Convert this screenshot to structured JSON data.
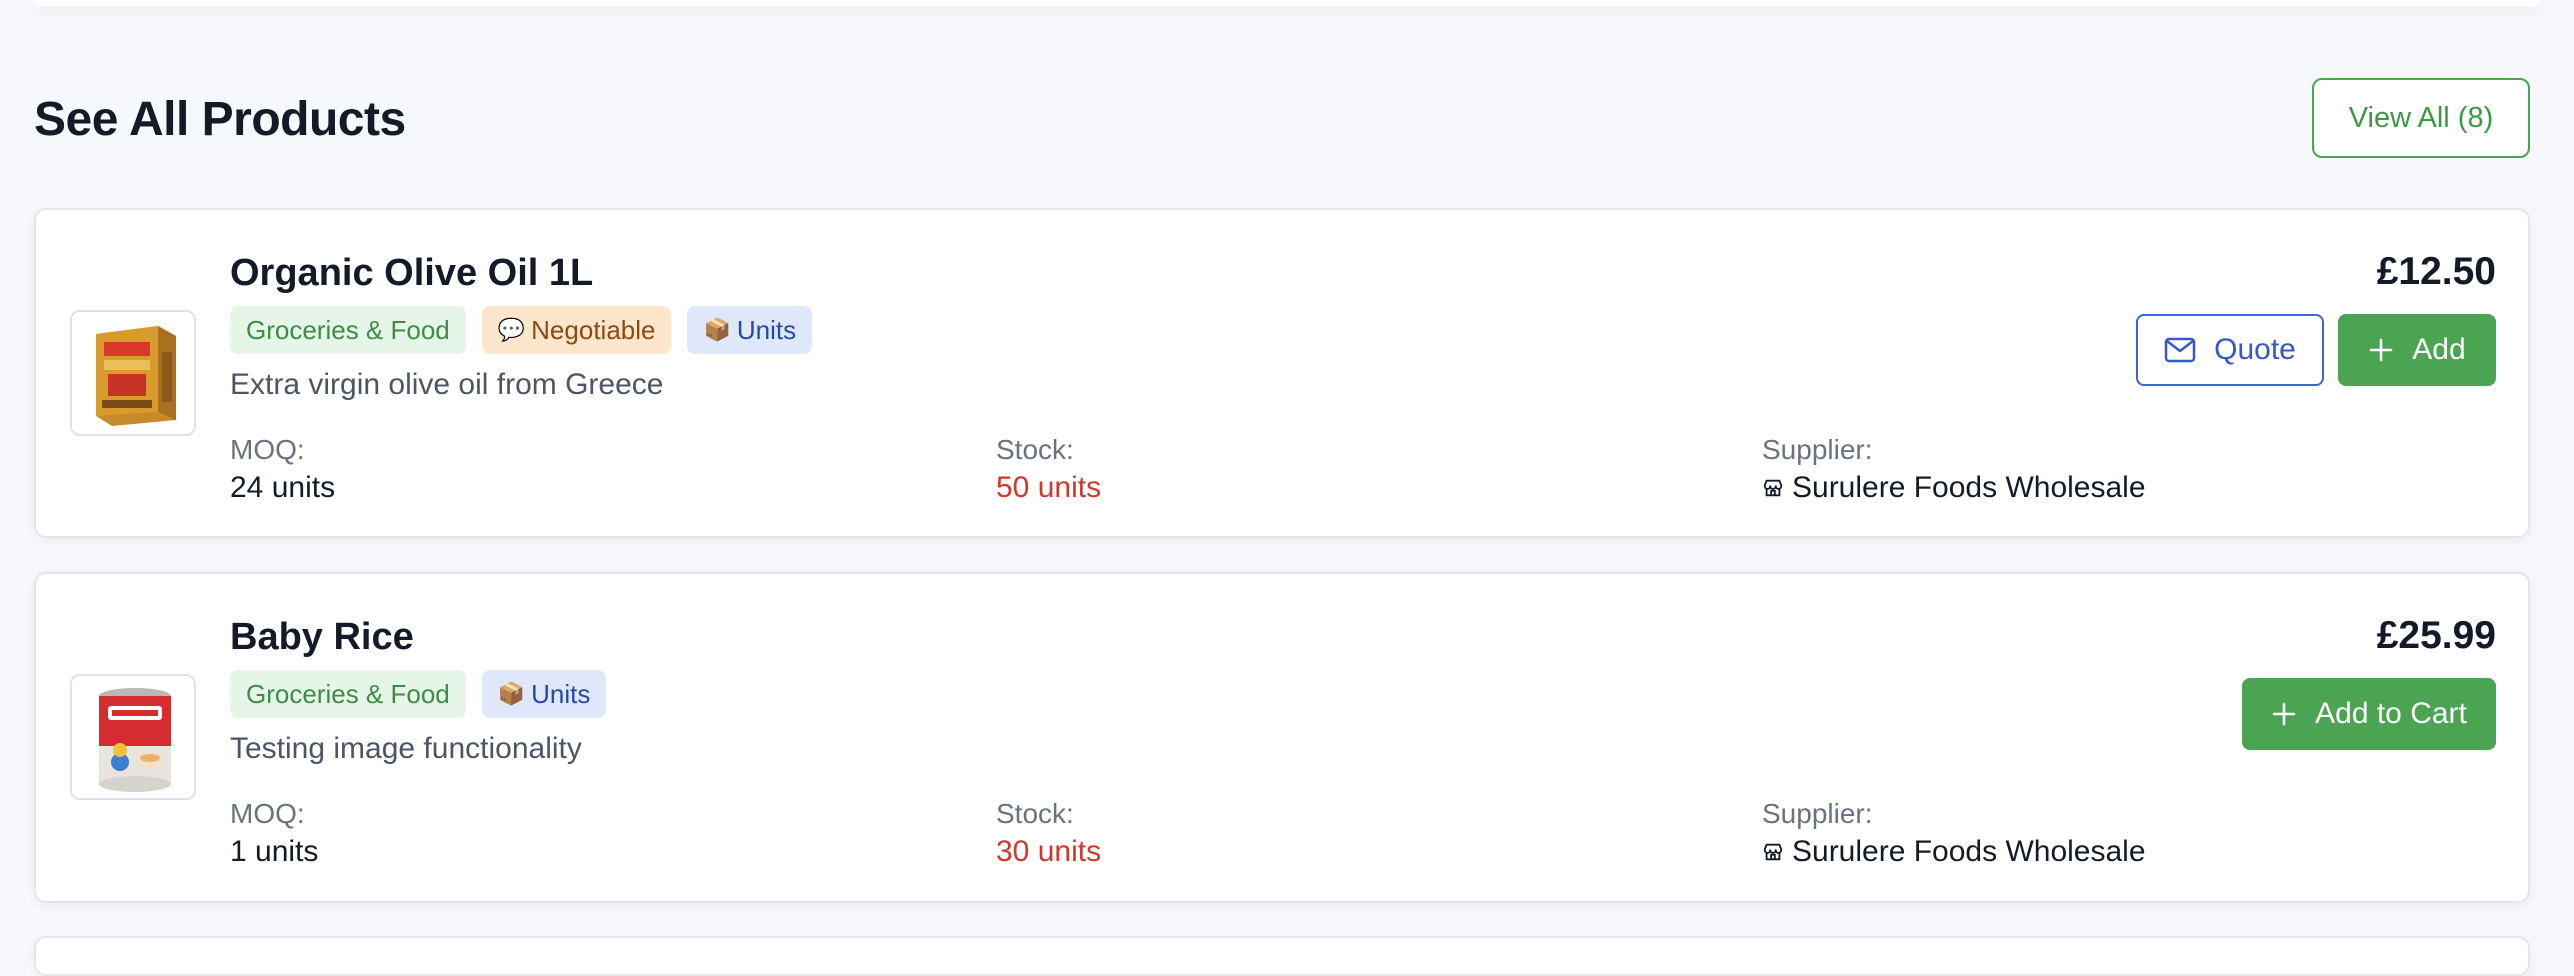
{
  "section": {
    "title": "See All Products",
    "view_all_label": "View All (8)"
  },
  "products": [
    {
      "name": "Organic Olive Oil 1L",
      "tags": {
        "category": "Groceries & Food",
        "negotiable": "Negotiable",
        "units": "Units"
      },
      "description": "Extra virgin olive oil from Greece",
      "moq_label": "MOQ:",
      "moq_value": "24 units",
      "stock_label": "Stock:",
      "stock_value": "50 units",
      "supplier_label": "Supplier:",
      "supplier_value": "Surulere Foods Wholesale",
      "price": "£12.50",
      "quote_label": "Quote",
      "add_label": "Add"
    },
    {
      "name": "Baby Rice",
      "tags": {
        "category": "Groceries & Food",
        "units": "Units"
      },
      "description": "Testing image functionality",
      "moq_label": "MOQ:",
      "moq_value": "1 units",
      "stock_label": "Stock:",
      "stock_value": "30 units",
      "supplier_label": "Supplier:",
      "supplier_value": "Surulere Foods Wholesale",
      "price": "£25.99",
      "add_label": "Add to Cart"
    }
  ],
  "icons": {
    "negotiable": "speech-bubble-icon",
    "units": "package-icon",
    "supplier": "store-icon",
    "quote": "mail-icon",
    "add": "plus-icon"
  },
  "colors": {
    "accent_green": "#4aa452",
    "accent_blue": "#3f63d8",
    "stock_red": "#d1382a"
  }
}
